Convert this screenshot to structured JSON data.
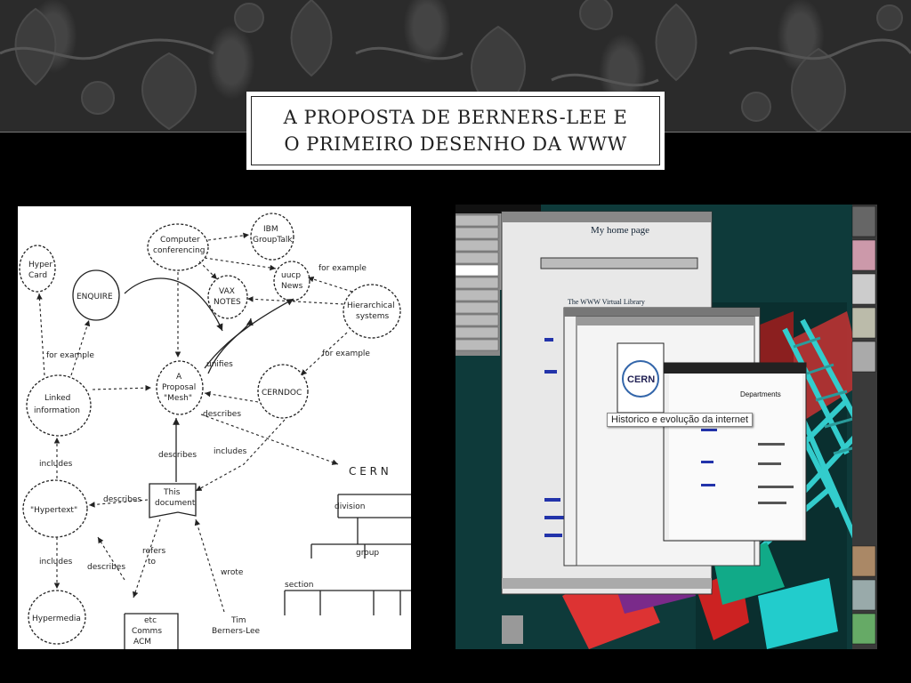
{
  "slide": {
    "title_line1": "A PROPOSTA DE BERNERS-LEE E",
    "title_line2": "O PRIMEIRO DESENHO DA WWW"
  },
  "diagram": {
    "nodes": {
      "ibm": "IBM",
      "groupTalk": "GroupTalk",
      "computer": "Computer",
      "conferencing": "conferencing",
      "hyperCard1": "Hyper",
      "hyperCard2": "Card",
      "enquire": "ENQUIRE",
      "vaxNotes1": "VAX",
      "vaxNotes2": "NOTES",
      "uucp1": "uucp",
      "uucp2": "News",
      "hierarchical1": "Hierarchical",
      "hierarchical2": "systems",
      "linked1": "Linked",
      "linked2": "information",
      "proposal1": "A",
      "proposal2": "Proposal",
      "proposal3": "\"Mesh\"",
      "cerndoc": "CERNDOC",
      "hypertext": "\"Hypertext\"",
      "document1": "This",
      "document2": "document",
      "hypermedia": "Hypermedia",
      "cern": "C E R N",
      "timbl1": "Tim",
      "timbl2": "Berners-Lee",
      "etc1": "etc",
      "etc2": "Comms",
      "etc3": "ACM"
    },
    "edges": {
      "forExample1": "for example",
      "forExample2": "for example",
      "forExample3": "for example",
      "unifies": "unifies",
      "describes1": "describes",
      "describes2": "describes",
      "describes3": "describes",
      "includes1": "includes",
      "includes2": "includes",
      "includes3": "includes",
      "refersTo1": "refers",
      "refersTo2": "to",
      "wrote": "wrote",
      "division": "division",
      "group": "group",
      "section": "section"
    }
  },
  "screenshot": {
    "myHomePage": "My home page",
    "virtualLibrary": "The WWW Virtual Library",
    "cernLogo": "CERN",
    "departments": "Departments",
    "tooltip": "Historico e evolução da internet"
  }
}
